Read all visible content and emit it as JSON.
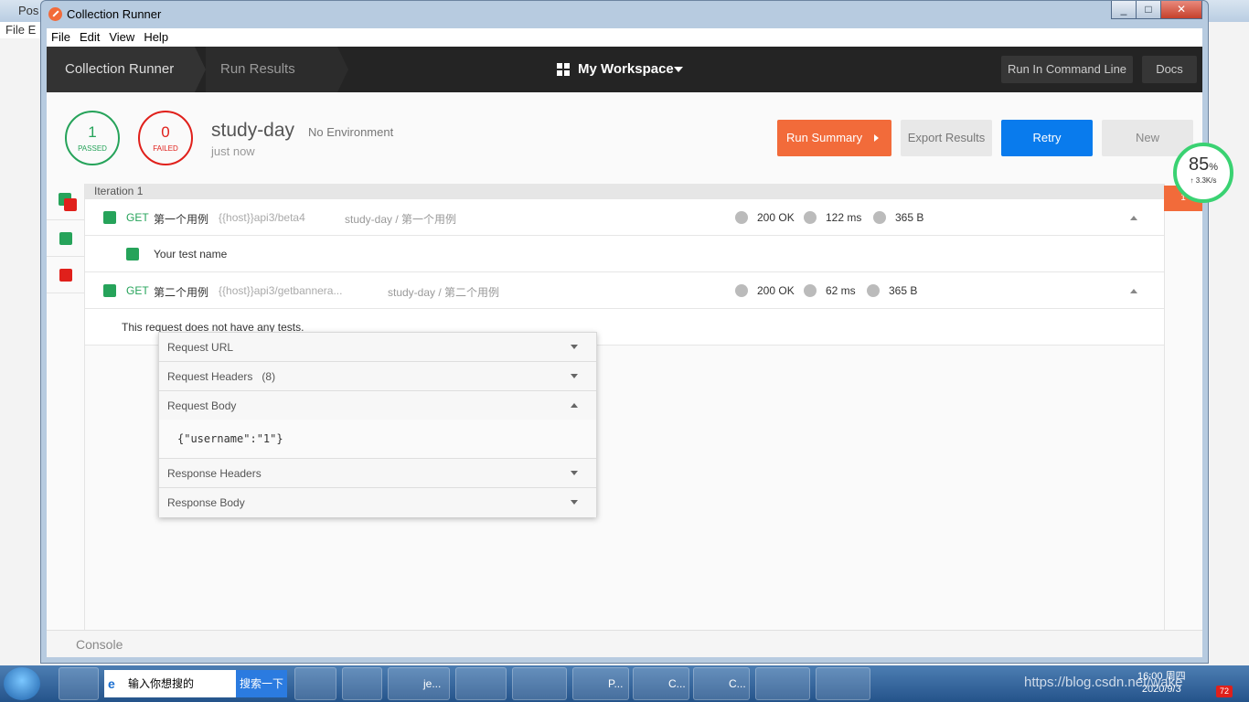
{
  "background_app": {
    "tab_title": "Pos",
    "menu_file": "File",
    "menu_edit_initial": "E"
  },
  "window": {
    "title": "Collection Runner",
    "controls": {
      "minimize": "_",
      "maximize": "□",
      "close": "✕"
    }
  },
  "menubar": {
    "items": [
      "File",
      "Edit",
      "View",
      "Help"
    ]
  },
  "topbar": {
    "breadcrumb_1": "Collection Runner",
    "breadcrumb_2": "Run Results",
    "workspace": "My Workspace",
    "run_cli": "Run In Command Line",
    "docs": "Docs"
  },
  "summary": {
    "passed_count": "1",
    "passed_label": "PASSED",
    "failed_count": "0",
    "failed_label": "FAILED",
    "collection_name": "study-day",
    "environment": "No Environment",
    "time": "just now",
    "buttons": {
      "run_summary": "Run Summary",
      "export": "Export Results",
      "retry": "Retry",
      "new": "New"
    }
  },
  "iteration": {
    "label": "Iteration 1",
    "badge": "1",
    "requests": [
      {
        "method": "GET",
        "name": "第一个用例",
        "url": "{{host}}api3/beta4",
        "path": "study-day / 第一个用例",
        "status": "200 OK",
        "time": "122 ms",
        "size": "365 B",
        "test": "Your test name"
      },
      {
        "method": "GET",
        "name": "第二个用例",
        "url": "{{host}}api3/getbannera...",
        "path": "study-day / 第二个用例",
        "status": "200 OK",
        "time": "62 ms",
        "size": "365 B",
        "no_tests": "This request does not have any tests."
      }
    ]
  },
  "details_panel": {
    "request_url": "Request URL",
    "request_headers": "Request Headers",
    "request_headers_count": "(8)",
    "request_body": "Request Body",
    "request_body_content": "{\"username\":\"1\"}",
    "response_headers": "Response Headers",
    "response_body": "Response Body"
  },
  "console": {
    "label": "Console"
  },
  "perf_widget": {
    "percent": "85",
    "percent_sign": "%",
    "speed": "↑ 3.3K/s"
  },
  "taskbar": {
    "search_placeholder": "输入你想搜的",
    "search_button": "搜索一下",
    "items": [
      "je...",
      "P...",
      "C...",
      "C..."
    ],
    "clock_time": "16:00 周四",
    "clock_date": "2020/9/3",
    "watermark": "https://blog.csdn.net/wake",
    "notification_count": "72"
  },
  "colors": {
    "accent_orange": "#f26b3a",
    "pass_green": "#26a35a",
    "fail_red": "#e0201b",
    "retry_blue": "#097bed",
    "topbar_dark": "#242424"
  }
}
